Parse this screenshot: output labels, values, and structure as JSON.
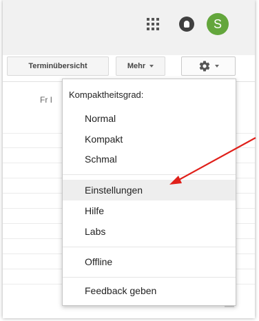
{
  "header": {
    "apps_icon": "apps-grid-icon",
    "notifications_icon": "notifications-icon",
    "avatar_letter": "S",
    "avatar_color": "#63a63c"
  },
  "toolbar": {
    "termin_label": "Terminübersicht",
    "mehr_label": "Mehr",
    "gear_icon": "gear-icon"
  },
  "calendar": {
    "day_label_partial": "Fr I"
  },
  "menu": {
    "heading": "Kompaktheitsgrad:",
    "density_items": [
      "Normal",
      "Kompakt",
      "Schmal"
    ],
    "items": [
      "Einstellungen",
      "Hilfe",
      "Labs"
    ],
    "offline": "Offline",
    "feedback": "Feedback geben",
    "highlighted": "Einstellungen"
  },
  "annotation": {
    "arrow_color": "#e0201a"
  }
}
